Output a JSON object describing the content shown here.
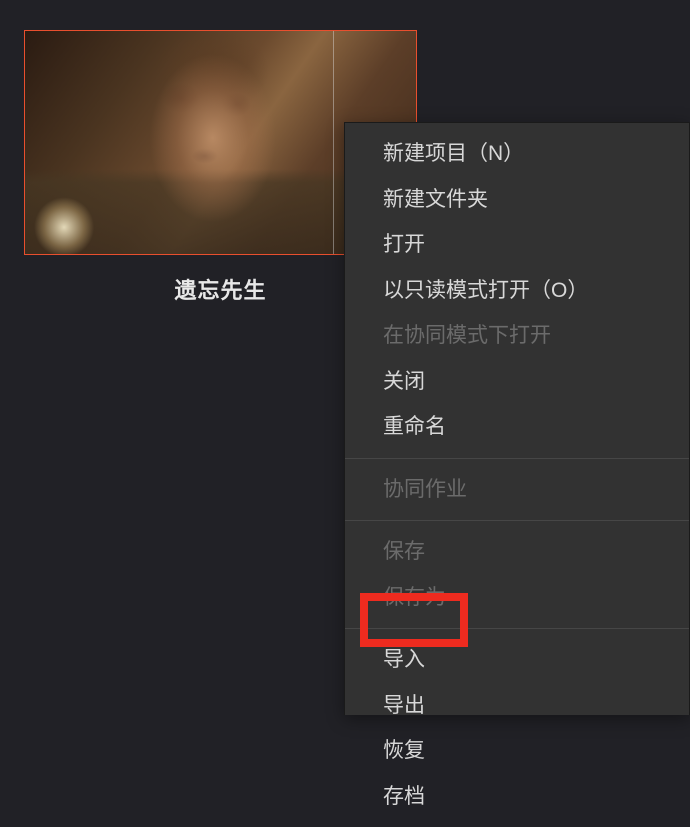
{
  "thumbnail": {
    "title": "遗忘先生"
  },
  "menu": {
    "sections": [
      [
        {
          "label": "新建项目（N）",
          "enabled": true,
          "name": "menu-new-project"
        },
        {
          "label": "新建文件夹",
          "enabled": true,
          "name": "menu-new-folder"
        },
        {
          "label": "打开",
          "enabled": true,
          "name": "menu-open"
        },
        {
          "label": "以只读模式打开（O）",
          "enabled": true,
          "name": "menu-open-readonly"
        },
        {
          "label": "在协同模式下打开",
          "enabled": false,
          "name": "menu-open-collab"
        },
        {
          "label": "关闭",
          "enabled": true,
          "name": "menu-close"
        },
        {
          "label": "重命名",
          "enabled": true,
          "name": "menu-rename"
        }
      ],
      [
        {
          "label": "协同作业",
          "enabled": false,
          "name": "menu-collab-work"
        }
      ],
      [
        {
          "label": "保存",
          "enabled": false,
          "name": "menu-save"
        },
        {
          "label": "保存为",
          "enabled": false,
          "name": "menu-save-as"
        }
      ],
      [
        {
          "label": "导入",
          "enabled": true,
          "name": "menu-import"
        },
        {
          "label": "导出",
          "enabled": true,
          "name": "menu-export"
        },
        {
          "label": "恢复",
          "enabled": true,
          "name": "menu-restore"
        },
        {
          "label": "存档",
          "enabled": true,
          "name": "menu-archive"
        }
      ]
    ]
  },
  "highlighted_item": "menu-export",
  "colors": {
    "background": "#212126",
    "menu_bg": "#323232",
    "selection_border": "#e94f2e",
    "highlight_box": "#ee2b1f",
    "text_enabled": "#d8d8d8",
    "text_disabled": "#6b6b6b"
  }
}
